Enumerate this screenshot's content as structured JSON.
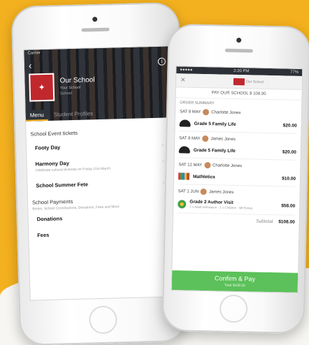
{
  "left_phone": {
    "status": {
      "carrier": "Carrier",
      "time": "",
      "battery": ""
    },
    "school": {
      "name": "Our School",
      "subtitle": "Your School",
      "subtitle2": "School"
    },
    "tabs": {
      "menu": "Menu",
      "student_profiles": "Student Profiles"
    },
    "menu": {
      "event_tickets_heading": "School Event tickets",
      "items_events": [
        {
          "label": "Footy Day",
          "sub": ""
        },
        {
          "label": "Harmony Day",
          "sub": "Celebrate cultural diversity on Friday 21st March"
        },
        {
          "label": "School Summer Fete",
          "sub": ""
        }
      ],
      "payments_heading": "School Payments",
      "payments_sub": "Books, School Contributions, Donations, Fees and More",
      "items_payments": [
        {
          "label": "Donations"
        },
        {
          "label": "Fees"
        }
      ],
      "chevron": "›"
    }
  },
  "right_phone": {
    "status": {
      "left": "●●●●● ",
      "time": "2:20 PM",
      "battery": "77%"
    },
    "header": {
      "close": "✕",
      "logo_text": "Our School"
    },
    "pay_title": "PAY OUR SCHOOL $ 108.00",
    "order_summary_label": "ORDER SUMMARY",
    "groups": [
      {
        "date": "SAT 8 MAY",
        "person": "Charlotte Jones",
        "item": "Grade 5 Family Life",
        "price": "$20.00",
        "icon": "hands-icon"
      },
      {
        "date": "SAT 8 MAY",
        "person": "James Jones",
        "item": "Grade 5 Family Life",
        "price": "$20.00",
        "icon": "hands-icon"
      },
      {
        "date": "SAT 12 MAY",
        "person": "Charlotte Jones",
        "item": "Mathletics",
        "price": "$10.00",
        "icon": "mathletics-icon"
      },
      {
        "date": "SAT 1 JUN",
        "person": "James Jones",
        "item": "Grade 2 Author Visit",
        "price": "$58.00",
        "icon": "author-icon",
        "sub": "1 x Adult Admission · 1 x Children · $8 Extras"
      }
    ],
    "subtotal_label": "Subtotal",
    "subtotal_value": "$108.00",
    "confirm": {
      "label": "Confirm & Pay",
      "sub": "Total $108.00"
    }
  },
  "colors": {
    "brand_yellow": "#f4b11f",
    "confirm_green": "#5cc15a",
    "school_red": "#c0282d"
  }
}
